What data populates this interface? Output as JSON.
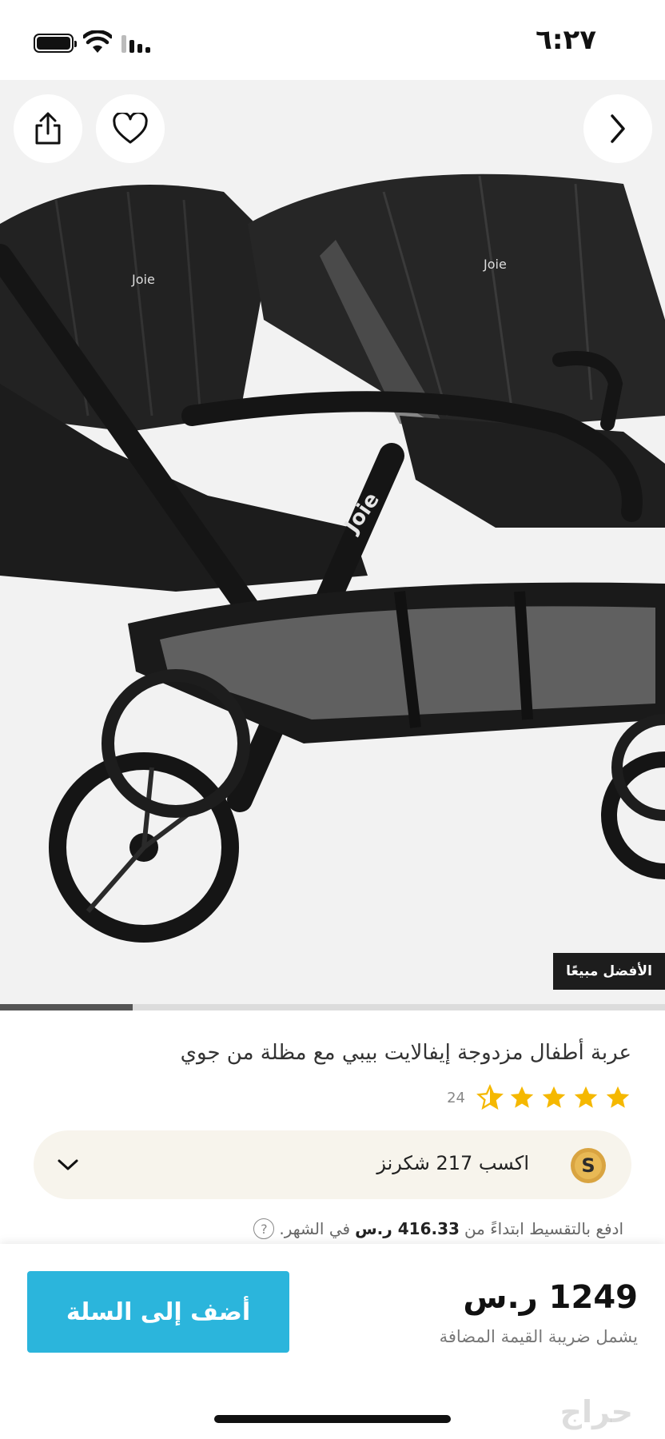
{
  "status_bar": {
    "time": "٦:٢٧"
  },
  "gallery": {
    "badge": "الأفضل مبيعًا",
    "progress_fraction": 0.2,
    "image_logo": "Joie",
    "icons": {
      "share": "share-icon",
      "favorite": "heart-icon",
      "next": "chevron-right-icon"
    }
  },
  "product": {
    "title": "عربة أطفال مزدوجة إيفالايت بيبي مع مظلة من جوي",
    "rating": 4.5,
    "rating_count": "24"
  },
  "rewards": {
    "text": "اكسب 217 شكرنز",
    "coin_letter": "S"
  },
  "installment": {
    "prefix": "ادفع بالتقسيط ابتداءً من",
    "amount": "416.33 ر.س",
    "suffix": "في الشهر.",
    "help": "?"
  },
  "purchase": {
    "price": "1249 ر.س",
    "vat_note": "يشمل ضريبة القيمة المضافة",
    "add_to_cart_label": "أضف إلى السلة"
  },
  "watermark": "حراج",
  "colors": {
    "accent": "#2bb5dc",
    "star": "#f5b800",
    "rewards_bg": "#f7f4ec",
    "badge_bg": "#1d1d1d"
  }
}
